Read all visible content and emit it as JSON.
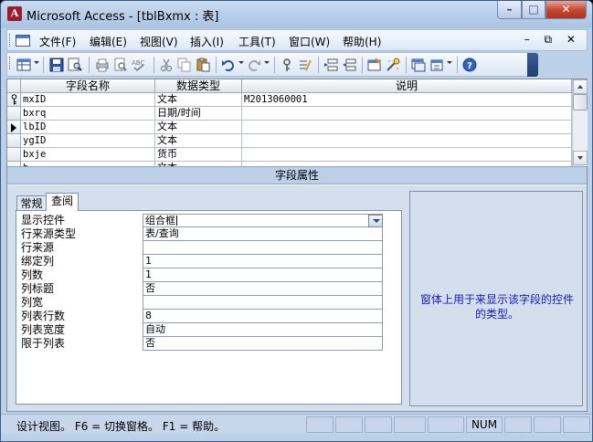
{
  "window": {
    "title": "Microsoft Access - [tblBxmx : 表]",
    "app_icon": "access-icon",
    "caption_buttons": {
      "minimize": "–",
      "maximize": "□",
      "close": "✕"
    }
  },
  "menubar": {
    "items": [
      {
        "label": "文件(F)"
      },
      {
        "label": "编辑(E)"
      },
      {
        "label": "视图(V)"
      },
      {
        "label": "插入(I)"
      },
      {
        "label": "工具(T)"
      },
      {
        "label": "窗口(W)"
      },
      {
        "label": "帮助(H)"
      }
    ],
    "mdi_controls": "–  ⧉  ✕"
  },
  "grid": {
    "headers": {
      "field_name": "字段名称",
      "data_type": "数据类型",
      "description": "说明"
    },
    "rows": [
      {
        "field_name": "mxID",
        "data_type": "文本",
        "description": "M2013060001",
        "primary_key": true,
        "current": false
      },
      {
        "field_name": "bxrq",
        "data_type": "日期/时间",
        "description": "",
        "primary_key": false,
        "current": false
      },
      {
        "field_name": "lbID",
        "data_type": "文本",
        "description": "",
        "primary_key": false,
        "current": true
      },
      {
        "field_name": "ygID",
        "data_type": "文本",
        "description": "",
        "primary_key": false,
        "current": false
      },
      {
        "field_name": "bxje",
        "data_type": "货币",
        "description": "",
        "primary_key": false,
        "current": false
      },
      {
        "field_name": "b",
        "data_type": "文本",
        "description": "",
        "primary_key": false,
        "current": false
      }
    ]
  },
  "properties": {
    "band_title": "字段属性",
    "tabs": [
      {
        "label": "常规",
        "active": false
      },
      {
        "label": "查阅",
        "active": true
      }
    ],
    "rows": [
      {
        "label": "显示控件",
        "value": "组合框"
      },
      {
        "label": "行来源类型",
        "value": "表/查询"
      },
      {
        "label": "行来源",
        "value": ""
      },
      {
        "label": "绑定列",
        "value": "1"
      },
      {
        "label": "列数",
        "value": "1"
      },
      {
        "label": "列标题",
        "value": "否"
      },
      {
        "label": "列宽",
        "value": ""
      },
      {
        "label": "列表行数",
        "value": "8"
      },
      {
        "label": "列表宽度",
        "value": "自动"
      },
      {
        "label": "限于列表",
        "value": "否"
      }
    ],
    "help_text": "窗体上用于来显示该字段的控件的类型。"
  },
  "statusbar": {
    "text": "设计视图。  F6 = 切换窗格。  F1 = 帮助。",
    "num": "NUM"
  },
  "colors": {
    "help_text": "#1a1ab0",
    "close_button": "#c74a33",
    "chrome": "#bcd0e8"
  }
}
